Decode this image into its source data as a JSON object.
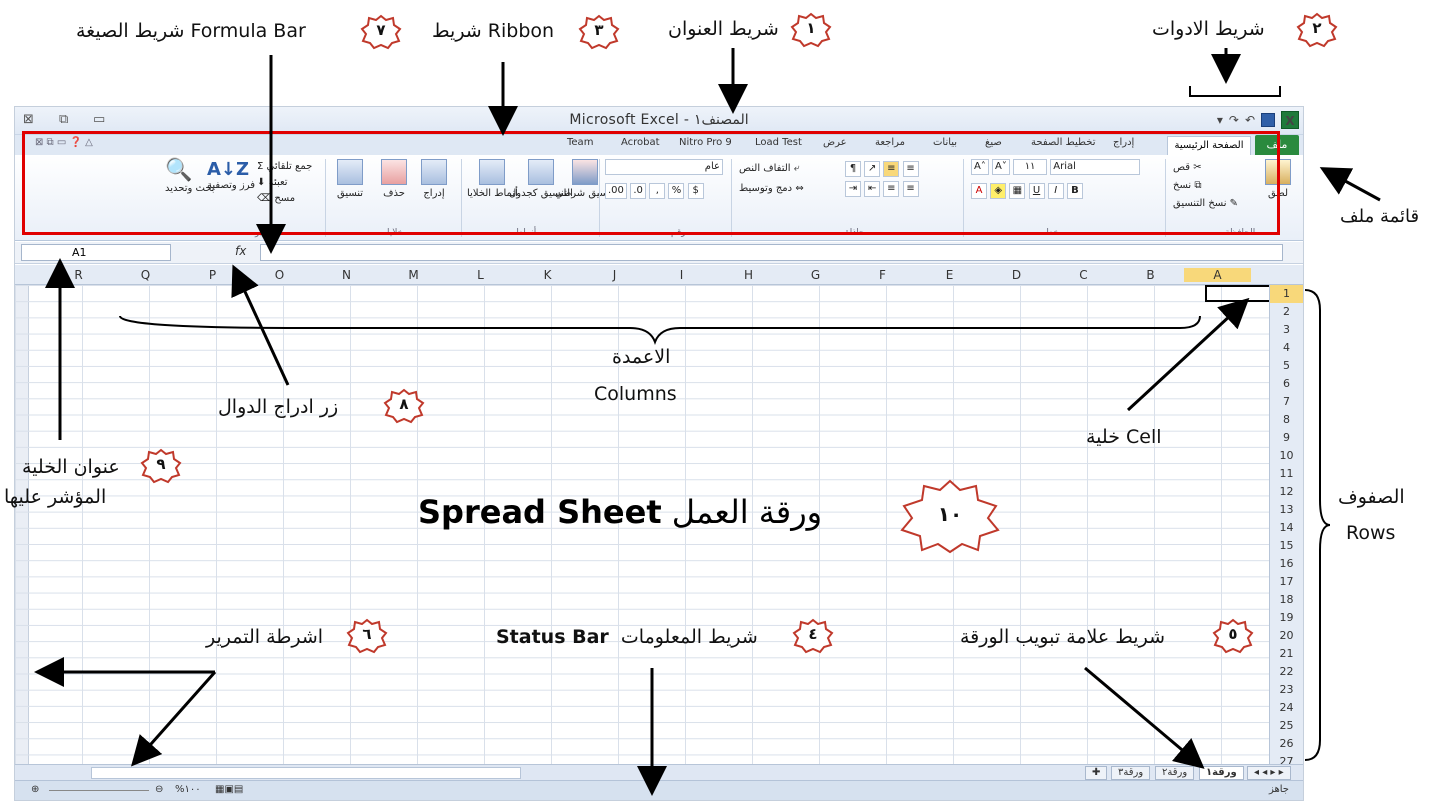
{
  "window": {
    "title": "Microsoft Excel - المصنف١",
    "controls": [
      "⊠",
      "⧉",
      "▭"
    ]
  },
  "tabs": [
    "Team",
    "Acrobat",
    "Nitro Pro 9",
    "Load Test",
    "عرض",
    "مراجعة",
    "بيانات",
    "صيغ",
    "تخطيط الصفحة",
    "إدراج"
  ],
  "tab_home": "الصفحة الرئيسية",
  "tab_file": "ملف",
  "ribbon": {
    "clipboard_paste": "لصق",
    "clipboard_cut": "قص",
    "clipboard_copy": "نسخ",
    "clipboard_format": "نسخ التنسيق",
    "font_name": "Arial",
    "font_size": "١١",
    "bold": "B",
    "italic": "I",
    "underline": "U",
    "wrap_text": "التفاف النص",
    "merge_center": "دمج وتوسيط",
    "number_format": "عام",
    "percent": "%",
    "cond_format": "تنسيق شرطي",
    "format_table": "التنسيق كجدول",
    "cell_styles": "أنماط الخلايا",
    "insert": "إدراج",
    "delete": "حذف",
    "format": "تنسيق",
    "autosum": "جمع تلقائي",
    "fill": "تعبئة",
    "clear": "مسح",
    "sort_filter": "فرز وتصفية",
    "find_select": "بحث وتحديد",
    "group_clipboard": "الحافظة",
    "group_font": "خط",
    "group_alignment": "محاذاة",
    "group_number": "رقم",
    "group_styles": "أنماط",
    "group_cells": "خلايا",
    "group_editing": "تحرير"
  },
  "formula_bar": {
    "name_box": "A1",
    "fx": "fx"
  },
  "columns": [
    "R",
    "Q",
    "P",
    "O",
    "N",
    "M",
    "L",
    "K",
    "J",
    "I",
    "H",
    "G",
    "F",
    "E",
    "D",
    "C",
    "B",
    "A"
  ],
  "rows": [
    "1",
    "2",
    "3",
    "4",
    "5",
    "6",
    "7",
    "8",
    "9",
    "10",
    "11",
    "12",
    "13",
    "14",
    "15",
    "16",
    "17",
    "18",
    "19",
    "20",
    "21",
    "22",
    "23",
    "24",
    "25",
    "26",
    "27"
  ],
  "sheets": [
    "ورقة١",
    "ورقة٢",
    "ورقة٣"
  ],
  "status": {
    "ready": "جاهز",
    "zoom": "%١٠٠"
  },
  "annotations": {
    "a1": "شريط العنوان",
    "a2": "شريط الادوات",
    "a3": "شريط Ribbon",
    "a7": "شريط الصيغة Formula Bar",
    "file_menu": "قائمة ملف",
    "columns_ar": "الاعمدة",
    "columns_en": "Columns",
    "a8": "زر ادراج الدوال",
    "cell": "خلية Cell",
    "a9_line1": "عنوان الخلية",
    "a9_line2": "المؤشر عليها",
    "a10_ar": "ورقة العمل",
    "a10_en": "Spread Sheet",
    "rows_ar": "الصفوف",
    "rows_en": "Rows",
    "a6": "اشرطة التمرير",
    "a4_ar": "شريط المعلومات",
    "a4_en": "Status Bar",
    "a5": "شريط علامة تبويب الورقة"
  },
  "badges": {
    "b1": "١",
    "b2": "٢",
    "b3": "٣",
    "b4": "٤",
    "b5": "٥",
    "b6": "٦",
    "b7": "٧",
    "b8": "٨",
    "b9": "٩",
    "b10": "١٠"
  }
}
